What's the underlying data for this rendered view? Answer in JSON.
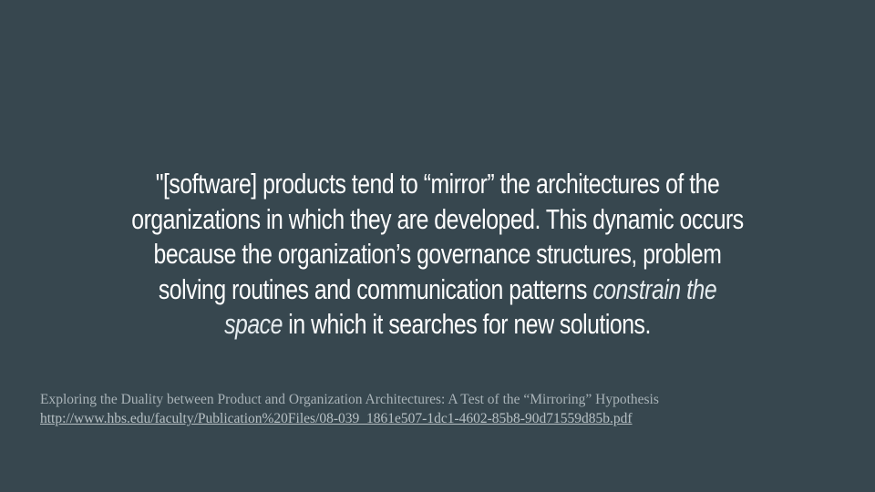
{
  "slide": {
    "background_color": "#37474f",
    "text_color": "#ffffff",
    "quote": {
      "line1": "\"[software] products tend to “mirror” the architectures of the",
      "line2": "organizations in which they are developed. This dynamic occurs",
      "line3": "because the organization’s governance structures, problem",
      "line4_plain": "solving routines and communication patterns ",
      "line4_italic": "constrain the",
      "line5_italic": "space",
      "line5_plain": " in which it searches for new solutions."
    },
    "citation": {
      "title": "Exploring the Duality between Product and Organization Architectures: A Test of the “Mirroring” Hypothesis",
      "url": "http://www.hbs.edu/faculty/Publication%20Files/08-039_1861e507-1dc1-4602-85b8-90d71559d85b.pdf",
      "color": "#a9b3b8"
    }
  }
}
